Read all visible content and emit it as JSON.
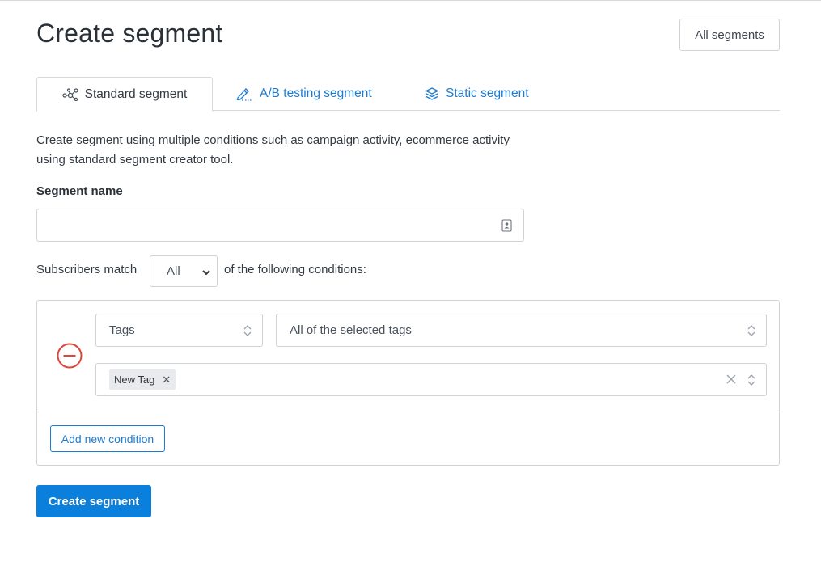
{
  "header": {
    "title": "Create segment",
    "all_segments_label": "All segments"
  },
  "tabs": [
    {
      "label": "Standard segment",
      "icon": "network-nodes-icon",
      "active": true
    },
    {
      "label": "A/B testing segment",
      "icon": "pen-signature-icon",
      "active": false
    },
    {
      "label": "Static segment",
      "icon": "layers-icon",
      "active": false
    }
  ],
  "description": "Create segment using multiple conditions such as campaign activity, ecommerce activity using standard segment creator tool.",
  "segment_name": {
    "label": "Segment name",
    "value": "",
    "placeholder": "",
    "icon": "contact-card-icon"
  },
  "match": {
    "prefix": "Subscribers match",
    "selected": "All",
    "suffix": "of the following conditions:"
  },
  "condition": {
    "field": "Tags",
    "mode": "All of the selected tags",
    "tags": [
      "New Tag"
    ],
    "remove_icon": "minus-circle-icon"
  },
  "buttons": {
    "add_condition": "Add new condition",
    "create": "Create segment"
  },
  "colors": {
    "accent": "#1f7bd1",
    "primary_button": "#0b7fdc",
    "remove_red": "#e0453b",
    "chip_bg": "#e8eaed"
  }
}
